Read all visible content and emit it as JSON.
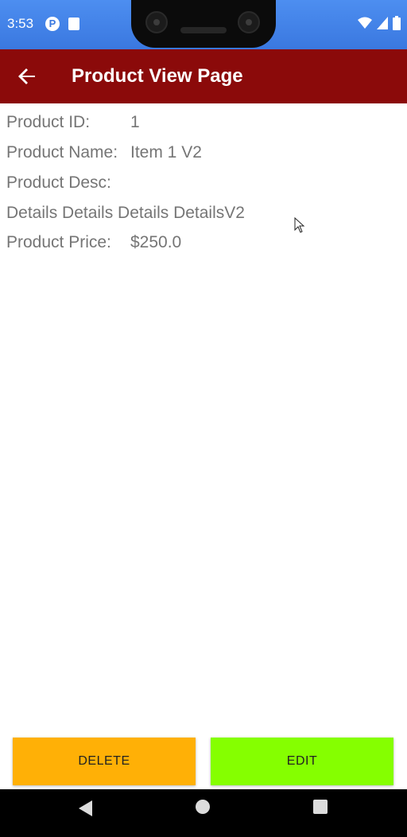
{
  "status": {
    "time": "3:53"
  },
  "appbar": {
    "title": "Product View Page"
  },
  "product": {
    "id_label": "Product ID:",
    "id_value": "1",
    "name_label": "Product Name:",
    "name_value": "Item 1 V2",
    "desc_label": "Product Desc:",
    "desc_value": "Details Details Details DetailsV2",
    "price_label": "Product Price:",
    "price_value": "$250.0"
  },
  "actions": {
    "delete_label": "DELETE",
    "edit_label": "EDIT"
  },
  "colors": {
    "status_bar": "#3a78e0",
    "app_bar": "#8b0a0a",
    "delete_button": "#ffb006",
    "edit_button": "#85ff00",
    "text_muted": "#757575"
  },
  "icons": {
    "back": "arrow-left",
    "nav_back": "triangle-left",
    "nav_home": "circle",
    "nav_recents": "square"
  }
}
